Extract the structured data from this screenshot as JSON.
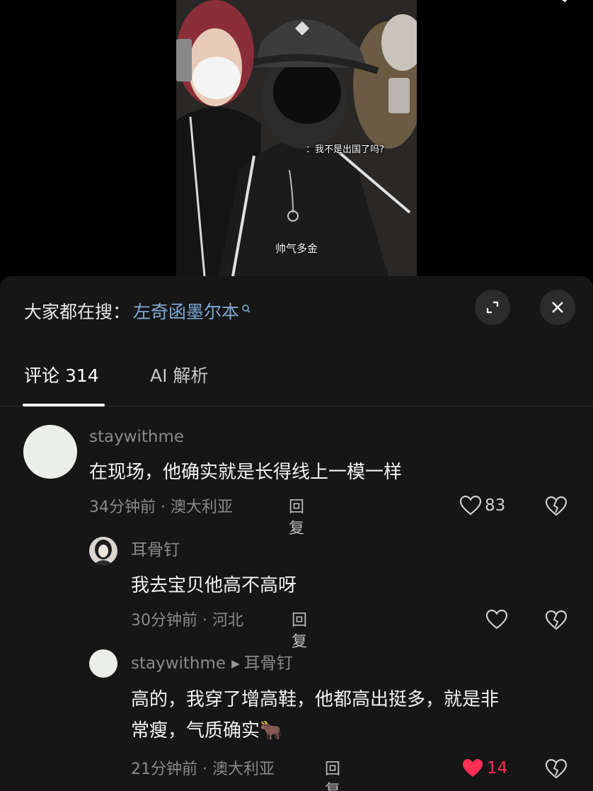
{
  "video": {
    "subtitle_top": "：我不是出国了吗?",
    "subtitle_bottom": "帅气多金"
  },
  "search": {
    "prefix": "大家都在搜：",
    "term": "左奇函墨尔本",
    "term_color": "#7fa9d6"
  },
  "tabs": [
    {
      "label": "评论 314",
      "active": true
    },
    {
      "label": "AI 解析",
      "active": false
    }
  ],
  "comments": [
    {
      "username": "staywithme",
      "text": "在现场，他确实就是长得线上一模一样",
      "meta": "34分钟前 · 澳大利亚",
      "reply_label": "回复",
      "likes": "83",
      "liked": false,
      "avatar_icon": "plain-avatar"
    },
    {
      "username": "耳骨钉",
      "text": "我去宝贝他高不高呀",
      "meta": "30分钟前 · 河北",
      "reply_label": "回复",
      "likes": "",
      "liked": false,
      "avatar_icon": "photo-avatar"
    },
    {
      "username": "staywithme",
      "reply_to": "耳骨钉",
      "text_line1": "高的，我穿了增高鞋，他都高出挺多，就是非",
      "text_line2": "常瘦，气质确实",
      "emoji": "🐂",
      "meta": "21分钟前 · 澳大利亚",
      "reply_label": "回复",
      "likes": "14",
      "liked": true,
      "like_color": "#ff2f55",
      "avatar_icon": "plain-avatar"
    }
  ]
}
